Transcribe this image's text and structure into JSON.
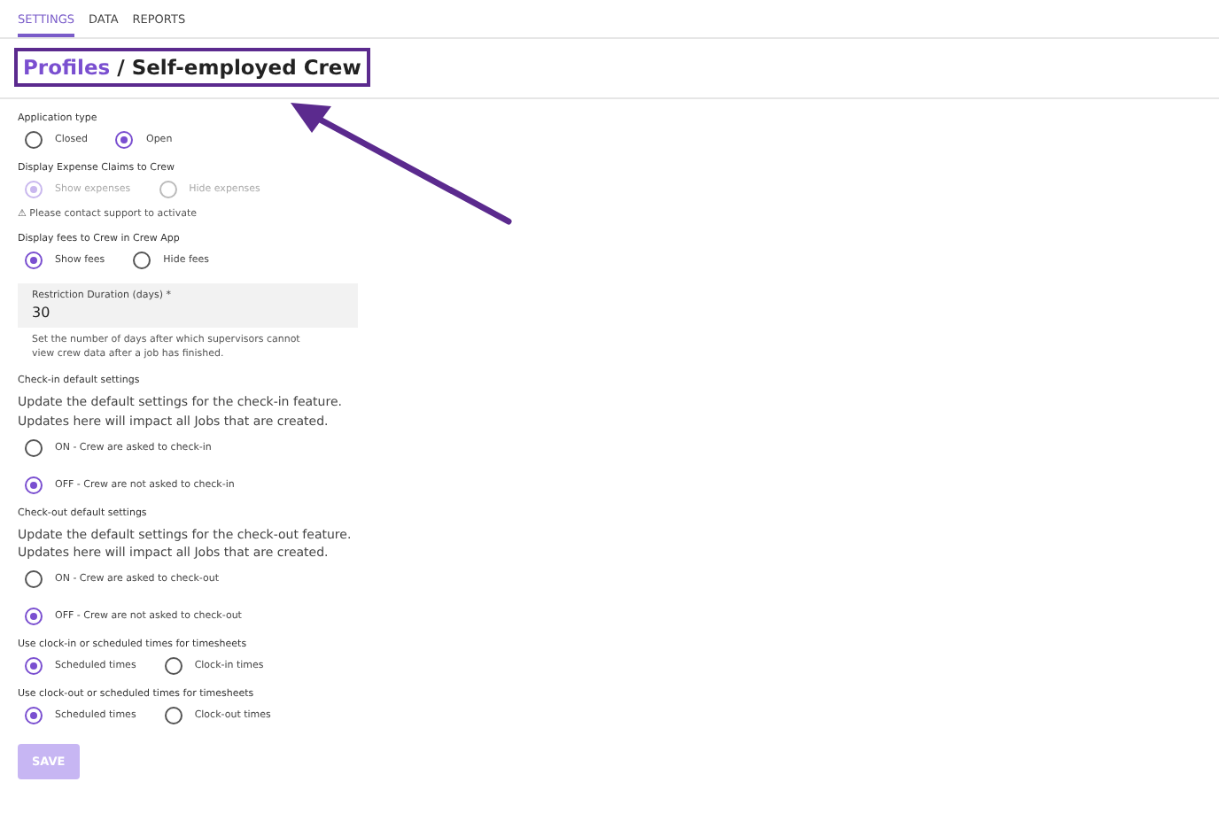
{
  "tabs": [
    {
      "label": "SETTINGS",
      "selected": true
    },
    {
      "label": "DATA",
      "selected": false
    },
    {
      "label": "REPORTS",
      "selected": false
    }
  ],
  "title": {
    "link": "Profiles",
    "separator": "/",
    "current": "Self-employed Crew"
  },
  "sections": [
    {
      "kind": "radio-inline",
      "label": "Application type",
      "disabled": false,
      "options": [
        {
          "label": "Closed",
          "selected": false
        },
        {
          "label": "Open",
          "selected": true
        }
      ]
    },
    {
      "kind": "radio-inline",
      "label": "Display Expense Claims to Crew",
      "disabled": true,
      "note": "⚠ Please contact support to activate",
      "options": [
        {
          "label": "Show expenses",
          "selected": true
        },
        {
          "label": "Hide expenses",
          "selected": false
        }
      ]
    },
    {
      "kind": "radio-inline",
      "label": "Display fees to Crew in Crew App",
      "disabled": false,
      "options": [
        {
          "label": "Show fees",
          "selected": true
        },
        {
          "label": "Hide fees",
          "selected": false
        }
      ]
    },
    {
      "kind": "field",
      "label": "Restriction Duration (days) *",
      "value": "30",
      "help": "Set the number of days after which supervisors cannot view crew data after a job has finished."
    },
    {
      "kind": "radio-stacked",
      "label": "Check-in default settings",
      "description": "Update the default settings for the check-in feature. Updates here will impact all Jobs that are created.",
      "disabled": false,
      "options": [
        {
          "label": "ON - Crew are asked to check-in",
          "selected": false
        },
        {
          "label": "OFF - Crew are not asked to check-in",
          "selected": true
        }
      ]
    },
    {
      "kind": "radio-stacked",
      "label": "Check-out default settings",
      "description": "Update the default settings for the check-out feature. Updates here will impact all Jobs that are created.",
      "disabled": false,
      "options": [
        {
          "label": "ON - Crew are asked to check-out",
          "selected": false
        },
        {
          "label": "OFF - Crew are not asked to check-out",
          "selected": true
        }
      ]
    },
    {
      "kind": "radio-inline",
      "label": "Use clock-in or scheduled times for timesheets",
      "disabled": false,
      "options": [
        {
          "label": "Scheduled times",
          "selected": true
        },
        {
          "label": "Clock-in times",
          "selected": false
        }
      ]
    },
    {
      "kind": "radio-inline",
      "label": "Use clock-out or scheduled times for timesheets",
      "disabled": false,
      "options": [
        {
          "label": "Scheduled times",
          "selected": true
        },
        {
          "label": "Clock-out times",
          "selected": false
        }
      ]
    }
  ],
  "save": {
    "label": "SAVE",
    "disabled": true
  }
}
